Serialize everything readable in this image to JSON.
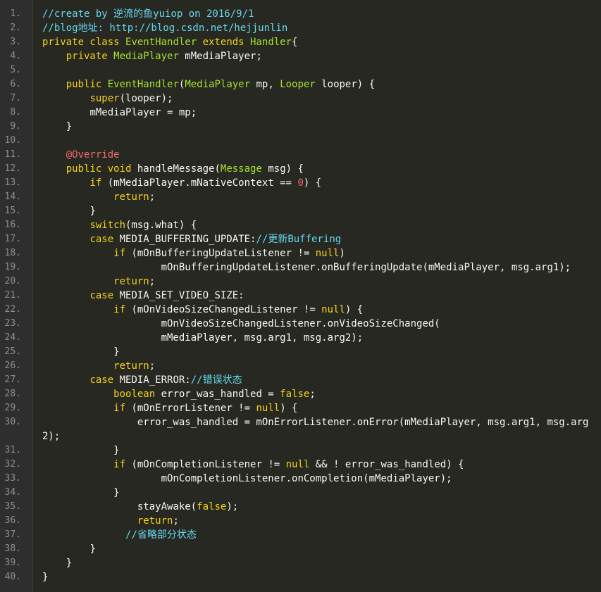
{
  "lines": [
    {
      "n": "1.",
      "tokens": [
        [
          "c",
          "//create by 逆流的鱼yuiop on 2016/9/1"
        ]
      ]
    },
    {
      "n": "2.",
      "tokens": [
        [
          "c",
          "//blog地址: http://blog.csdn.net/hejjunlin"
        ]
      ]
    },
    {
      "n": "3.",
      "tokens": [
        [
          "k",
          "private class "
        ],
        [
          "t",
          "EventHandler"
        ],
        [
          "k",
          " extends "
        ],
        [
          "t",
          "Handler"
        ],
        [
          "p",
          "{"
        ]
      ]
    },
    {
      "n": "4.",
      "tokens": [
        [
          "p",
          "    "
        ],
        [
          "k",
          "private "
        ],
        [
          "t",
          "MediaPlayer"
        ],
        [
          "p",
          " mMediaPlayer;"
        ]
      ]
    },
    {
      "n": "5.",
      "tokens": []
    },
    {
      "n": "6.",
      "tokens": [
        [
          "p",
          "    "
        ],
        [
          "k",
          "public "
        ],
        [
          "t",
          "EventHandler"
        ],
        [
          "p",
          "("
        ],
        [
          "t",
          "MediaPlayer"
        ],
        [
          "p",
          " mp, "
        ],
        [
          "t",
          "Looper"
        ],
        [
          "p",
          " looper) {"
        ]
      ]
    },
    {
      "n": "7.",
      "tokens": [
        [
          "p",
          "        "
        ],
        [
          "k",
          "super"
        ],
        [
          "p",
          "(looper);"
        ]
      ]
    },
    {
      "n": "8.",
      "tokens": [
        [
          "p",
          "        mMediaPlayer = mp;"
        ]
      ]
    },
    {
      "n": "9.",
      "tokens": [
        [
          "p",
          "    }"
        ]
      ]
    },
    {
      "n": "10.",
      "tokens": []
    },
    {
      "n": "11.",
      "tokens": [
        [
          "p",
          "    "
        ],
        [
          "a",
          "@Override"
        ]
      ]
    },
    {
      "n": "12.",
      "tokens": [
        [
          "p",
          "    "
        ],
        [
          "k",
          "public void "
        ],
        [
          "p",
          "handleMessage("
        ],
        [
          "t",
          "Message"
        ],
        [
          "p",
          " msg) {"
        ]
      ]
    },
    {
      "n": "13.",
      "tokens": [
        [
          "p",
          "        "
        ],
        [
          "k",
          "if "
        ],
        [
          "p",
          "(mMediaPlayer.mNativeContext == "
        ],
        [
          "n",
          "0"
        ],
        [
          "p",
          ") {"
        ]
      ]
    },
    {
      "n": "14.",
      "tokens": [
        [
          "p",
          "            "
        ],
        [
          "k",
          "return"
        ],
        [
          "p",
          ";"
        ]
      ]
    },
    {
      "n": "15.",
      "tokens": [
        [
          "p",
          "        }"
        ]
      ]
    },
    {
      "n": "16.",
      "tokens": [
        [
          "p",
          "        "
        ],
        [
          "k",
          "switch"
        ],
        [
          "p",
          "(msg.what) {"
        ]
      ]
    },
    {
      "n": "17.",
      "tokens": [
        [
          "p",
          "        "
        ],
        [
          "k",
          "case "
        ],
        [
          "p",
          "MEDIA_BUFFERING_UPDATE:"
        ],
        [
          "c",
          "//更新Buffering"
        ]
      ]
    },
    {
      "n": "18.",
      "tokens": [
        [
          "p",
          "            "
        ],
        [
          "k",
          "if "
        ],
        [
          "p",
          "(mOnBufferingUpdateListener != "
        ],
        [
          "k",
          "null"
        ],
        [
          "p",
          ")"
        ]
      ]
    },
    {
      "n": "19.",
      "tokens": [
        [
          "p",
          "                    mOnBufferingUpdateListener.onBufferingUpdate(mMediaPlayer, msg.arg1);"
        ]
      ]
    },
    {
      "n": "20.",
      "tokens": [
        [
          "p",
          "            "
        ],
        [
          "k",
          "return"
        ],
        [
          "p",
          ";"
        ]
      ]
    },
    {
      "n": "21.",
      "tokens": [
        [
          "p",
          "        "
        ],
        [
          "k",
          "case "
        ],
        [
          "p",
          "MEDIA_SET_VIDEO_SIZE:"
        ]
      ]
    },
    {
      "n": "22.",
      "tokens": [
        [
          "p",
          "            "
        ],
        [
          "k",
          "if "
        ],
        [
          "p",
          "(mOnVideoSizeChangedListener != "
        ],
        [
          "k",
          "null"
        ],
        [
          "p",
          ") {"
        ]
      ]
    },
    {
      "n": "23.",
      "tokens": [
        [
          "p",
          "                    mOnVideoSizeChangedListener.onVideoSizeChanged("
        ]
      ]
    },
    {
      "n": "24.",
      "tokens": [
        [
          "p",
          "                    mMediaPlayer, msg.arg1, msg.arg2);"
        ]
      ]
    },
    {
      "n": "25.",
      "tokens": [
        [
          "p",
          "            }"
        ]
      ]
    },
    {
      "n": "26.",
      "tokens": [
        [
          "p",
          "            "
        ],
        [
          "k",
          "return"
        ],
        [
          "p",
          ";"
        ]
      ]
    },
    {
      "n": "27.",
      "tokens": [
        [
          "p",
          "        "
        ],
        [
          "k",
          "case "
        ],
        [
          "p",
          "MEDIA_ERROR:"
        ],
        [
          "c",
          "//错误状态"
        ]
      ]
    },
    {
      "n": "28.",
      "tokens": [
        [
          "p",
          "            "
        ],
        [
          "k",
          "boolean "
        ],
        [
          "p",
          "error_was_handled = "
        ],
        [
          "k",
          "false"
        ],
        [
          "p",
          ";"
        ]
      ]
    },
    {
      "n": "29.",
      "tokens": [
        [
          "p",
          "            "
        ],
        [
          "k",
          "if "
        ],
        [
          "p",
          "(mOnErrorListener != "
        ],
        [
          "k",
          "null"
        ],
        [
          "p",
          ") {"
        ]
      ]
    },
    {
      "n": "30.",
      "tokens": [
        [
          "p",
          "                error_was_handled = mOnErrorListener.onError(mMediaPlayer, msg.arg1, msg.arg2);"
        ]
      ]
    },
    {
      "n": "31.",
      "tokens": [
        [
          "p",
          "            }"
        ]
      ]
    },
    {
      "n": "32.",
      "tokens": [
        [
          "p",
          "            "
        ],
        [
          "k",
          "if "
        ],
        [
          "p",
          "(mOnCompletionListener != "
        ],
        [
          "k",
          "null"
        ],
        [
          "p",
          " && ! error_was_handled) {"
        ]
      ]
    },
    {
      "n": "33.",
      "tokens": [
        [
          "p",
          "                    mOnCompletionListener.onCompletion(mMediaPlayer);"
        ]
      ]
    },
    {
      "n": "34.",
      "tokens": [
        [
          "p",
          "            }"
        ]
      ]
    },
    {
      "n": "35.",
      "tokens": [
        [
          "p",
          "                stayAwake("
        ],
        [
          "k",
          "false"
        ],
        [
          "p",
          ");"
        ]
      ]
    },
    {
      "n": "36.",
      "tokens": [
        [
          "p",
          "                "
        ],
        [
          "k",
          "return"
        ],
        [
          "p",
          ";"
        ]
      ]
    },
    {
      "n": "37.",
      "tokens": [
        [
          "p",
          "              "
        ],
        [
          "c",
          "//省略部分状态"
        ]
      ]
    },
    {
      "n": "38.",
      "tokens": [
        [
          "p",
          "        }"
        ]
      ]
    },
    {
      "n": "39.",
      "tokens": [
        [
          "p",
          "    }"
        ]
      ]
    },
    {
      "n": "40.",
      "tokens": [
        [
          "p",
          "}"
        ]
      ]
    }
  ]
}
